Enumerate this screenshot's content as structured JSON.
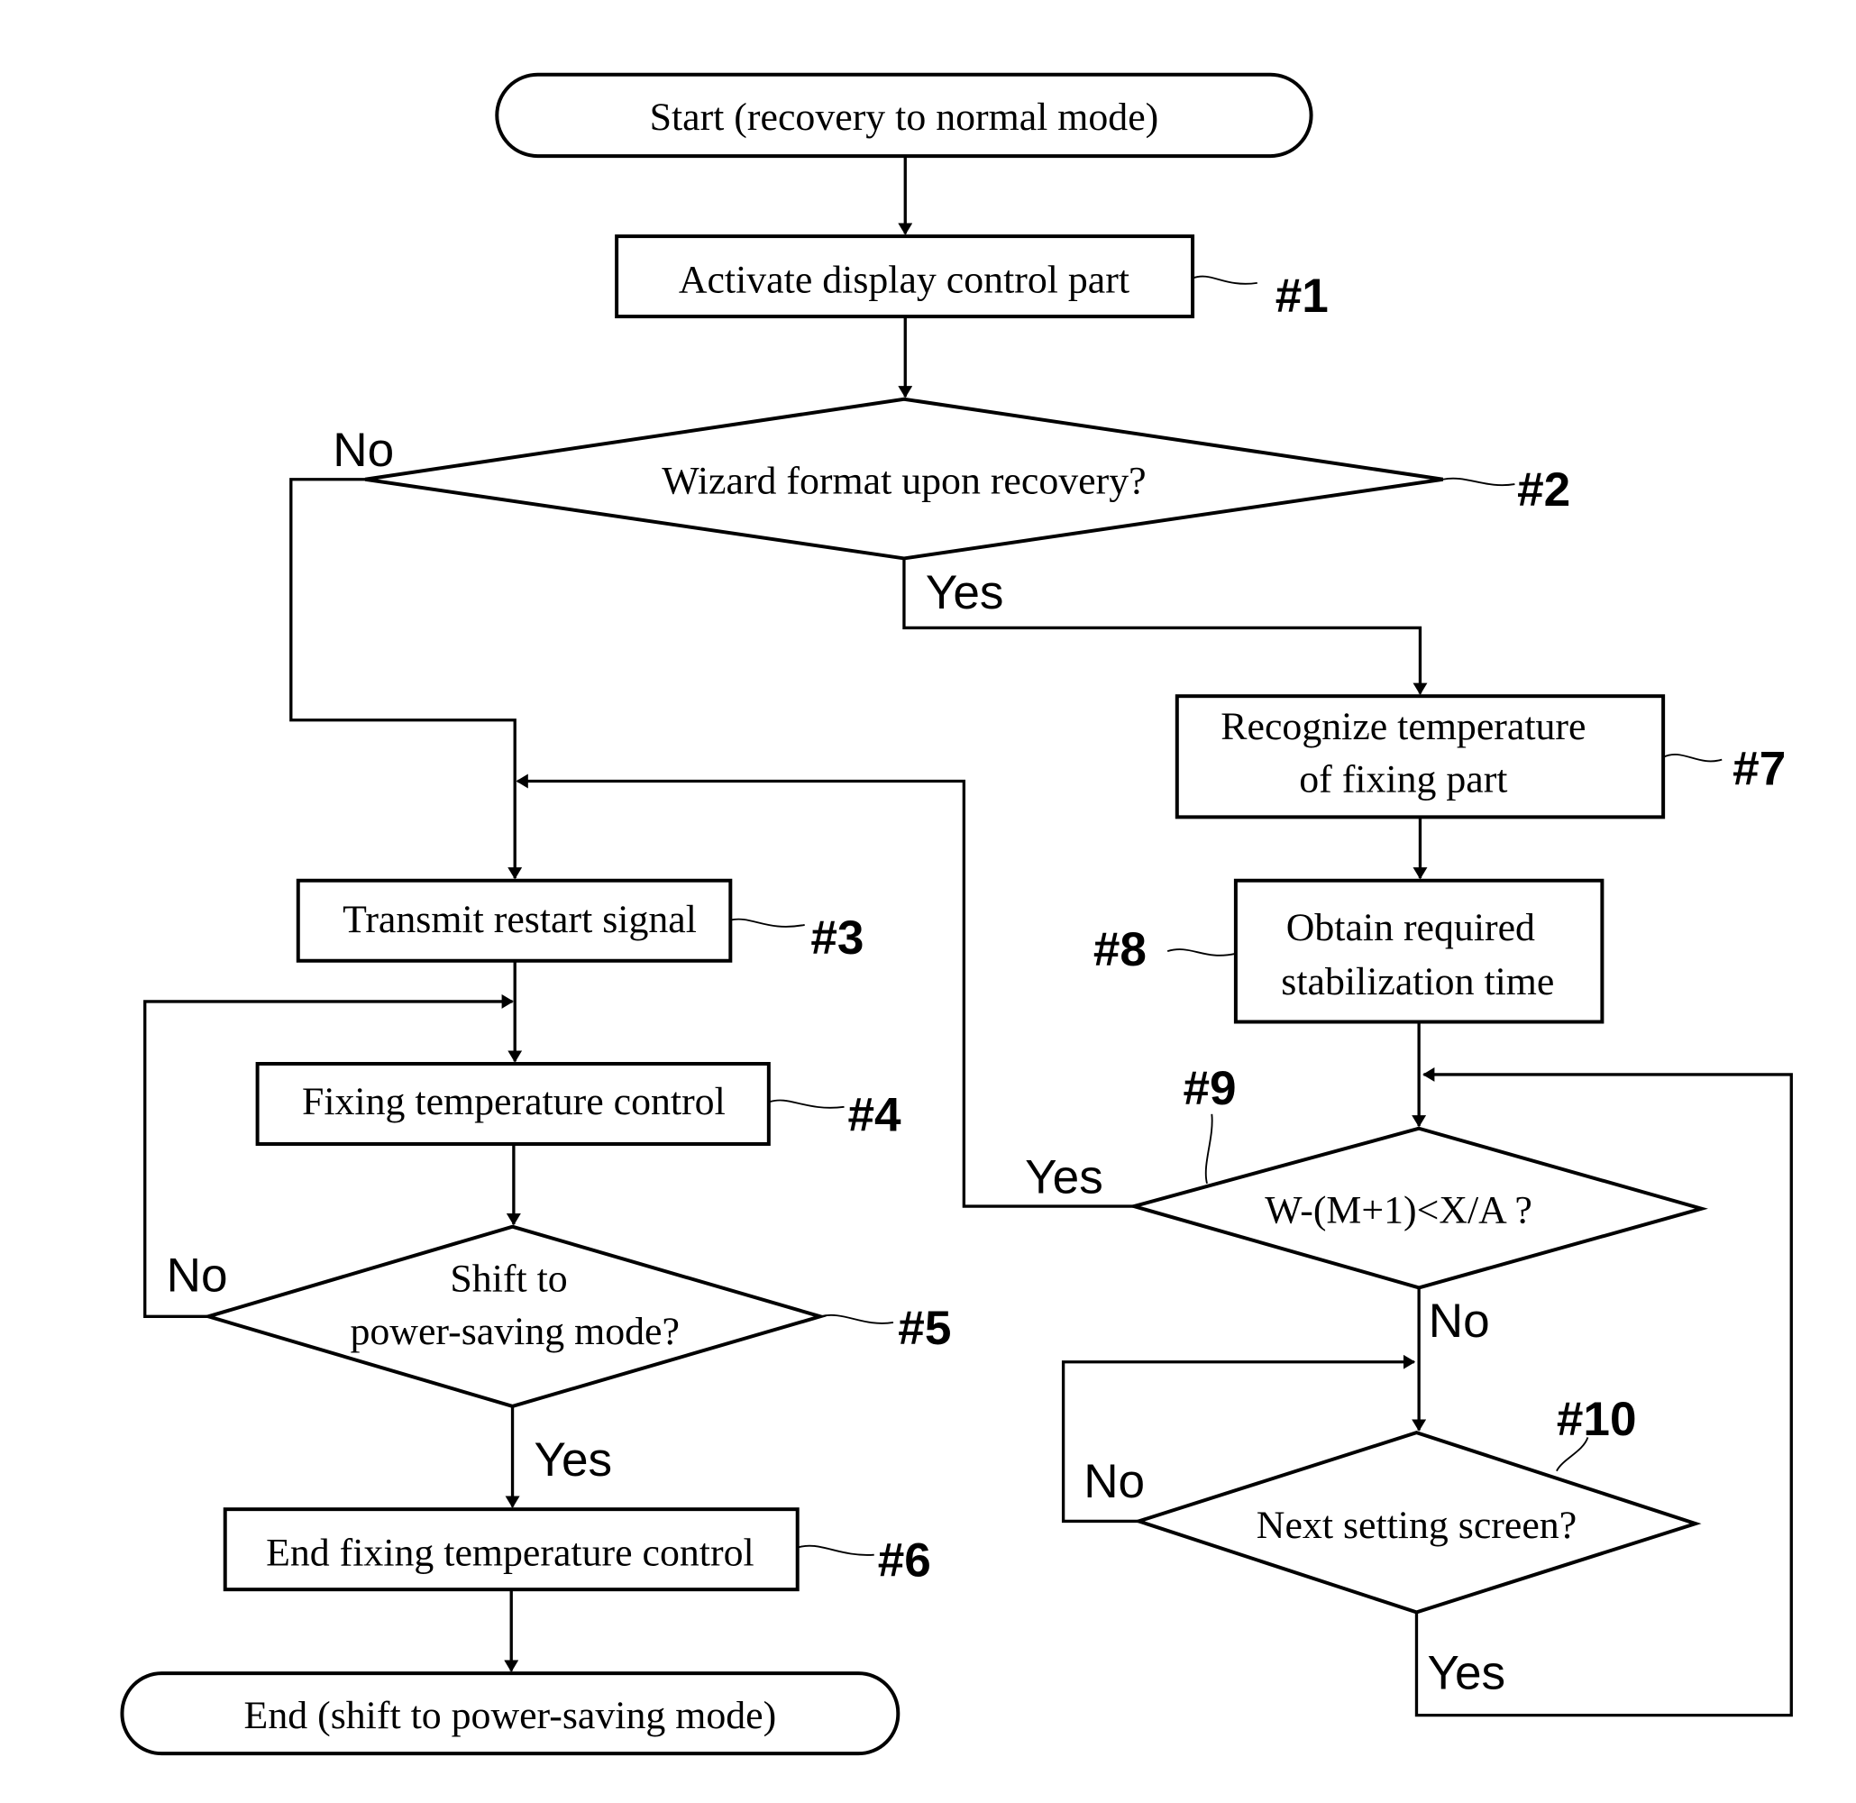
{
  "diagram": {
    "type": "flowchart",
    "nodes": {
      "start": {
        "label": "Start (recovery to normal mode)",
        "kind": "terminal"
      },
      "n1": {
        "label": "Activate display control part",
        "ref": "#1",
        "kind": "process"
      },
      "n2": {
        "label": "Wizard format upon recovery?",
        "ref": "#2",
        "kind": "decision"
      },
      "n3": {
        "label": "Transmit restart signal",
        "ref": "#3",
        "kind": "process"
      },
      "n4": {
        "label": "Fixing temperature control",
        "ref": "#4",
        "kind": "process"
      },
      "n5": {
        "line1": "Shift to",
        "line2": "power-saving mode?",
        "ref": "#5",
        "kind": "decision"
      },
      "n6": {
        "label": "End fixing temperature control",
        "ref": "#6",
        "kind": "process"
      },
      "end": {
        "label": "End (shift to power-saving mode)",
        "kind": "terminal"
      },
      "n7": {
        "line1": "Recognize temperature",
        "line2": "of fixing part",
        "ref": "#7",
        "kind": "process"
      },
      "n8": {
        "line1": "Obtain required",
        "line2": "stabilization time",
        "ref": "#8",
        "kind": "process"
      },
      "n9": {
        "label": "W-(M+1)<X/A ?",
        "ref": "#9",
        "kind": "decision"
      },
      "n10": {
        "label": "Next setting screen?",
        "ref": "#10",
        "kind": "decision"
      }
    },
    "edge_labels": {
      "n2_no": "No",
      "n2_yes": "Yes",
      "n5_no": "No",
      "n5_yes": "Yes",
      "n9_yes": "Yes",
      "n9_no": "No",
      "n10_no": "No",
      "n10_yes": "Yes"
    },
    "edges": [
      {
        "from": "start",
        "to": "n1"
      },
      {
        "from": "n1",
        "to": "n2"
      },
      {
        "from": "n2",
        "to": "n3",
        "label": "No"
      },
      {
        "from": "n2",
        "to": "n7",
        "label": "Yes"
      },
      {
        "from": "n3",
        "to": "n4"
      },
      {
        "from": "n4",
        "to": "n5"
      },
      {
        "from": "n5",
        "to": "n4",
        "label": "No"
      },
      {
        "from": "n5",
        "to": "n6",
        "label": "Yes"
      },
      {
        "from": "n6",
        "to": "end"
      },
      {
        "from": "n7",
        "to": "n8"
      },
      {
        "from": "n8",
        "to": "n9"
      },
      {
        "from": "n9",
        "to": "n3",
        "label": "Yes"
      },
      {
        "from": "n9",
        "to": "n10",
        "label": "No"
      },
      {
        "from": "n10",
        "to": "n10",
        "label": "No"
      },
      {
        "from": "n10",
        "to": "n9",
        "label": "Yes"
      }
    ]
  }
}
